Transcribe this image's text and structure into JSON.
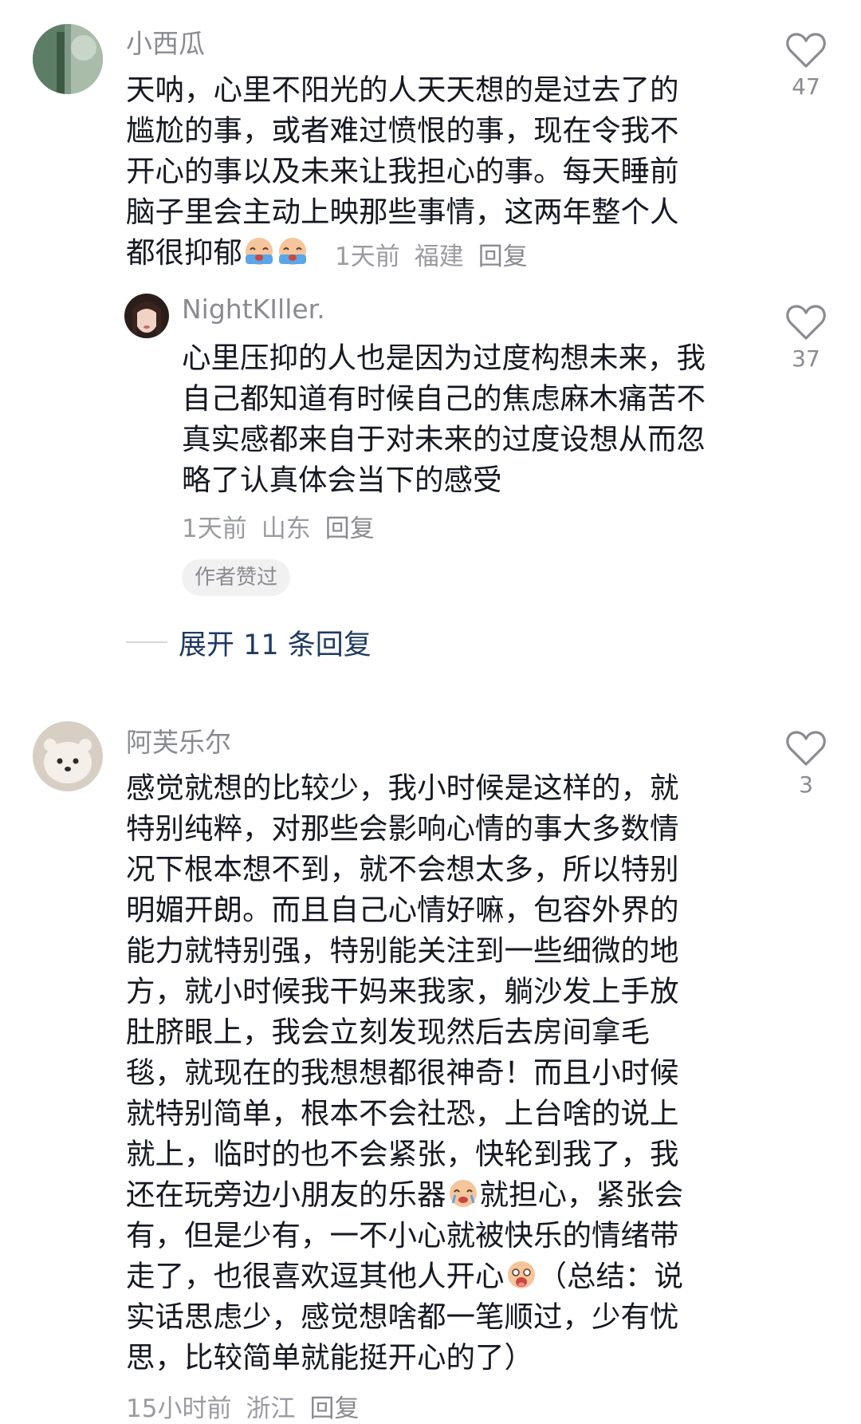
{
  "comments": [
    {
      "username": "小西瓜",
      "lines": [
        "天呐，心里不阳光的人天天想的是过去了的",
        "尴尬的事，或者难过愤恨的事，现在令我不",
        "开心的事以及未来让我担心的事。每天睡前",
        "脑子里会主动上映那些事情，这两年整个人",
        "都很抑郁"
      ],
      "time": "1天前",
      "location": "福建",
      "reply_label": "回复",
      "likes": "47",
      "emojis": [
        "crying-emoji",
        "crying-emoji"
      ]
    },
    {
      "username": "NightKIller.",
      "lines": [
        "心里压抑的人也是因为过度构想未来，我",
        "自己都知道有时候自己的焦虑麻木痛苦不",
        "真实感都来自于对未来的过度设想从而忽",
        "略了认真体会当下的感受"
      ],
      "time": "1天前",
      "location": "山东",
      "reply_label": "回复",
      "likes": "37",
      "author_liked": "作者赞过"
    },
    {
      "username": "阿芙乐尔",
      "lines": [
        "感觉就想的比较少，我小时候是这样的，就",
        "特别纯粹，对那些会影响心情的事大多数情",
        "况下根本想不到，就不会想太多，所以特别",
        "明媚开朗。而且自己心情好嘛，包容外界的",
        "能力就特别强，特别能关注到一些细微的地",
        "方，就小时候我干妈来我家，躺沙发上手放",
        "肚脐眼上，我会立刻发现然后去房间拿毛",
        "毯，就现在的我想想都很神奇！而且小时候",
        "就特别简单，根本不会社恐，上台啥的说上",
        "就上，临时的也不会紧张，快轮到我了，我",
        "还在玩旁边小朋友的乐器",
        "就担心，紧张会",
        "有，但是少有，一不小心就被快乐的情绪带",
        "走了，也很喜欢逗其他人开心",
        "（总结：说",
        "实话思虑少，感觉想啥都一笔顺过，少有忧",
        "思，比较简单就能挺开心的了）"
      ],
      "time": "15小时前",
      "location": "浙江",
      "reply_label": "回复",
      "likes": "3"
    }
  ],
  "expand_replies": "展开 11 条回复",
  "colors": {
    "text": "#161823",
    "secondary": "#8a8b91",
    "link": "#1f3a63",
    "pill_bg": "#f1f1f2"
  }
}
